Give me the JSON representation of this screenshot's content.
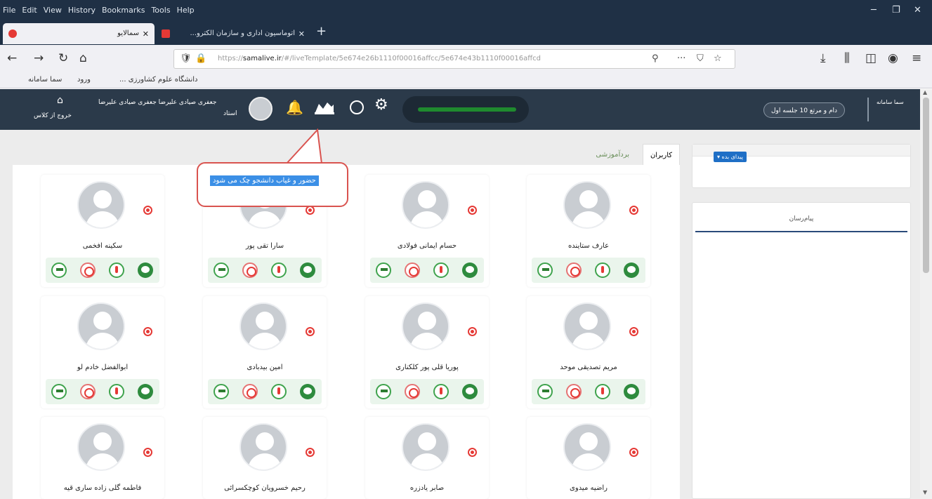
{
  "menu": [
    "File",
    "Edit",
    "View",
    "History",
    "Bookmarks",
    "Tools",
    "Help"
  ],
  "window_controls": {
    "minimize": "─",
    "restore": "❐",
    "close": "✕"
  },
  "tabs": [
    {
      "title": "سمالایو",
      "active": true
    },
    {
      "title": "اتوماسیون اداری و سازمان الکترو...",
      "active": false
    }
  ],
  "tab_close": "✕",
  "new_tab": "+",
  "url": {
    "prefix": "https://",
    "domain": "samalive.ir",
    "rest": "/#/liveTemplate/5e674e26b1110f00016affcc/5e674e43b1110f00016affcd"
  },
  "nav_icons": {
    "back": "←",
    "forward": "→",
    "reload": "↻",
    "home": "⌂",
    "shield": "🛡",
    "lock": "🔒",
    "key": "⚲",
    "more": "···",
    "pocket": "⛉",
    "star": "☆",
    "download": "⤓",
    "library": "⫼",
    "sidebar": "◫",
    "account": "◉",
    "menu": "≡"
  },
  "bookmarks": [
    "دانشگاه علوم کشاورزی ...",
    "ورود",
    "سما سامانه"
  ],
  "app": {
    "brand": "سما سامانه",
    "session": "دام و مرتع 10 جلسه اول",
    "user_name": "جعفری صیادی علیرضا جعفری صیادی علیرضا",
    "user_role": "استاد",
    "exit_label": "خروج از کلاس"
  },
  "content_tabs": [
    "کاربران",
    "بردآموزشی"
  ],
  "right_panel": {
    "button_label": "پیدای بده ▾",
    "messages_title": "پیام‌رسان"
  },
  "callout_text": "حضور و غیاب دانشجو چک می شود",
  "students": [
    "عارف ستاینده",
    "حسام ایمانی فولادی",
    "سارا تقی پور",
    "سکینه افخمی",
    "مریم تصدیقی موحد",
    "پوریا قلی پور کلکناری",
    "امین بیدبادی",
    "ابوالفضل خادم لو",
    "راضیه میدوی",
    "صابر یادزره",
    "رحیم خسرویان کوچکسرائی",
    "فاطمه گلی زاده ساری قیه"
  ]
}
